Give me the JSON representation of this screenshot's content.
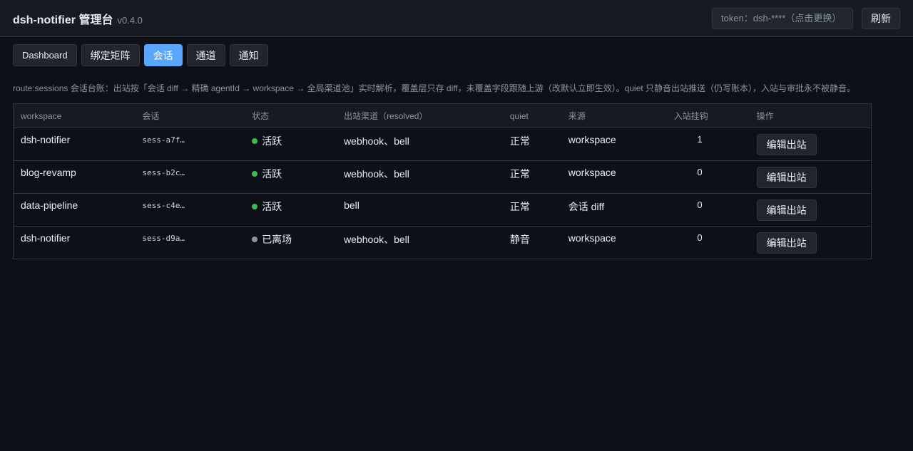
{
  "header": {
    "title": "dsh-notifier 管理台",
    "version": "v0.4.0",
    "token_placeholder": "token：dsh-****（点击更换）",
    "refresh_label": "刷新"
  },
  "tabs": [
    {
      "label": "Dashboard",
      "active": false
    },
    {
      "label": "绑定矩阵",
      "active": false
    },
    {
      "label": "会话",
      "active": true
    },
    {
      "label": "通道",
      "active": false
    },
    {
      "label": "通知",
      "active": false
    }
  ],
  "description": "route:sessions 会话台账：出站按「会话 diff → 精确 agentId → workspace → 全局渠道池」实时解析，覆盖层只存 diff，未覆盖字段跟随上游（改默认立即生效）。quiet 只静音出站推送（仍写账本），入站与审批永不被静音。",
  "table": {
    "columns": [
      "workspace",
      "会话",
      "状态",
      "出站渠道（resolved）",
      "quiet",
      "来源",
      "入站挂钩",
      "操作"
    ],
    "rows": [
      {
        "workspace": "dsh-notifier",
        "session": "sess-a7f…",
        "status": "活跃",
        "status_color": "#3fb950",
        "channels": "webhook、bell",
        "quiet": "正常",
        "source": "workspace",
        "hooks": "1",
        "action": "编辑出站"
      },
      {
        "workspace": "blog-revamp",
        "session": "sess-b2c…",
        "status": "活跃",
        "status_color": "#3fb950",
        "channels": "webhook、bell",
        "quiet": "正常",
        "source": "workspace",
        "hooks": "0",
        "action": "编辑出站"
      },
      {
        "workspace": "data-pipeline",
        "session": "sess-c4e…",
        "status": "活跃",
        "status_color": "#3fb950",
        "channels": "bell",
        "quiet": "正常",
        "source": "会话 diff",
        "hooks": "0",
        "action": "编辑出站"
      },
      {
        "workspace": "dsh-notifier",
        "session": "sess-d9a…",
        "status": "已离场",
        "status_color": "#8b949e",
        "channels": "webhook、bell",
        "quiet": "静音",
        "source": "workspace",
        "hooks": "0",
        "action": "编辑出站"
      }
    ]
  },
  "colors": {
    "background": "#0d1117",
    "surface": "#161b22",
    "accent": "#58a6ff",
    "border": "#30363d",
    "active_status": "#3fb950",
    "inactive_status": "#8b949e"
  }
}
